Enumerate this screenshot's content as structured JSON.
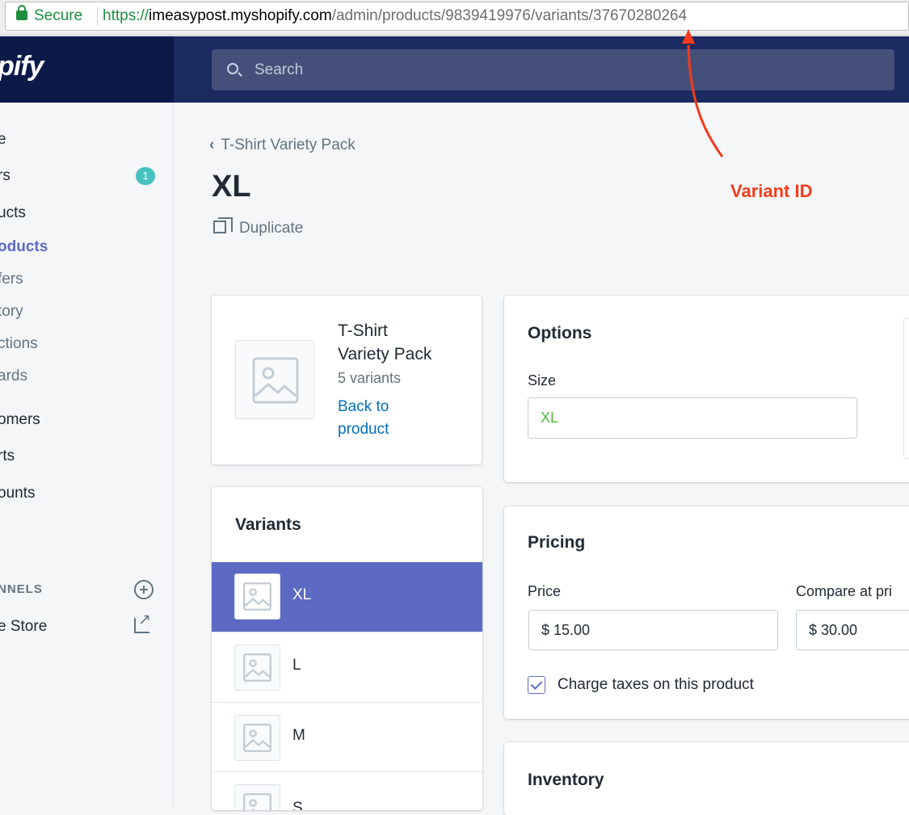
{
  "browser": {
    "secure_label": "Secure",
    "url_scheme": "https://",
    "url_host": "imeasypost.myshopify.com",
    "url_path": "/admin/products/9839419976/variants/37670280264"
  },
  "topbar": {
    "logo": "pify",
    "search_placeholder": "Search"
  },
  "sidebar": {
    "items": [
      {
        "label": "e"
      },
      {
        "label": "rs"
      },
      {
        "label": "ucts"
      },
      {
        "label": "oducts"
      },
      {
        "label": "fers"
      },
      {
        "label": "tory"
      },
      {
        "label": "ctions"
      },
      {
        "label": "ards"
      },
      {
        "label": "omers"
      },
      {
        "label": "rts"
      },
      {
        "label": "ounts"
      }
    ],
    "orders_badge": "1",
    "channels_heading": "NNELS",
    "online_store": "e Store"
  },
  "header": {
    "breadcrumb": "T-Shirt Variety Pack",
    "title": "XL",
    "duplicate_label": "Duplicate"
  },
  "annotation": {
    "label": "Variant ID",
    "color": "#f53c1c"
  },
  "product_card": {
    "name_line1": "T-Shirt",
    "name_line2": "Variety Pack",
    "variant_count": "5 variants",
    "back_line1": "Back to",
    "back_line2": "product"
  },
  "variants_card": {
    "title": "Variants",
    "items": [
      {
        "label": "XL",
        "selected": true
      },
      {
        "label": "L"
      },
      {
        "label": "M"
      },
      {
        "label": "S"
      }
    ]
  },
  "options_card": {
    "title": "Options",
    "size_label": "Size",
    "size_value": "XL"
  },
  "pricing_card": {
    "title": "Pricing",
    "price_label": "Price",
    "price_value": "$ 15.00",
    "compare_label": "Compare at pri",
    "compare_value": "$ 30.00",
    "charge_taxes_label": "Charge taxes on this product",
    "charge_taxes_checked": true
  },
  "inventory_card": {
    "title": "Inventory"
  },
  "colors": {
    "accent": "#5c6ac4",
    "topbar": "#1b2a60",
    "link": "#006fbb"
  }
}
